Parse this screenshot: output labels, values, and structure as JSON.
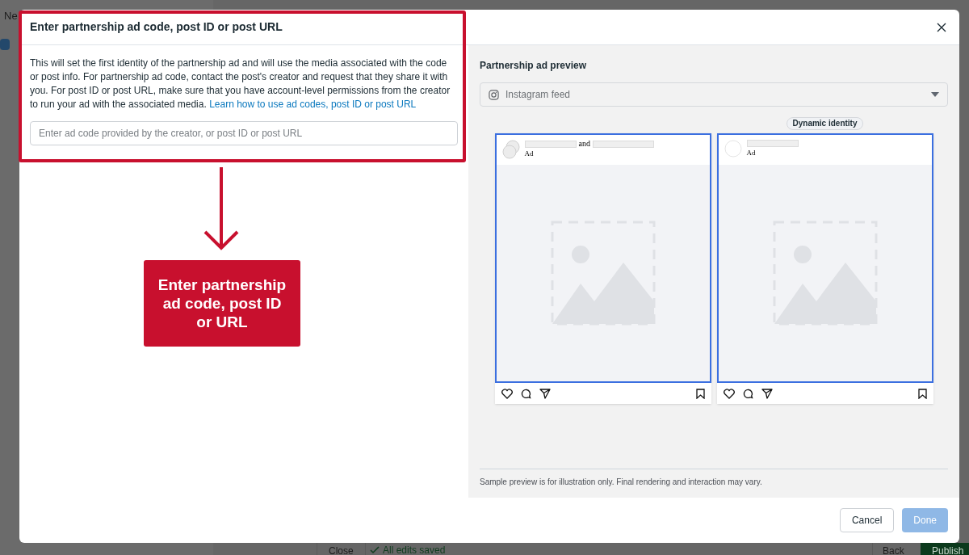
{
  "background_app": {
    "title_fragment": "Ne",
    "bottom_bar": {
      "close": "Close",
      "status": "All edits saved",
      "back": "Back",
      "publish": "Publish"
    }
  },
  "dialog": {
    "title": "Enter partnership ad code, post ID or post URL",
    "description": "This will set the first identity of the partnership ad and will use the media associated with the code or post info. For partnership ad code, contact the post's creator and request that they share it with you. For post ID or post URL, make sure that you have account-level permissions from the creator to run your ad with the associated media.",
    "link": "Learn how to use ad codes, post ID or post URL",
    "input": {
      "placeholder": "Enter ad code provided by the creator, or post ID or post URL"
    },
    "preview": {
      "title": "Partnership ad preview",
      "placement": "Instagram feed",
      "posts": [
        {
          "kind": "partnership",
          "joiner": "and",
          "label": "Ad",
          "highlighted": true
        },
        {
          "kind": "single",
          "badge": "Dynamic identity",
          "label": "Ad",
          "highlighted": true
        }
      ],
      "disclaimer": "Sample preview is for illustration only. Final rendering and interaction may vary."
    },
    "buttons": [
      {
        "label": "Cancel",
        "disabled": false
      },
      {
        "label": "Done",
        "disabled": true
      }
    ]
  },
  "annotation": {
    "callout": "Enter partnership ad code, post ID or URL"
  }
}
